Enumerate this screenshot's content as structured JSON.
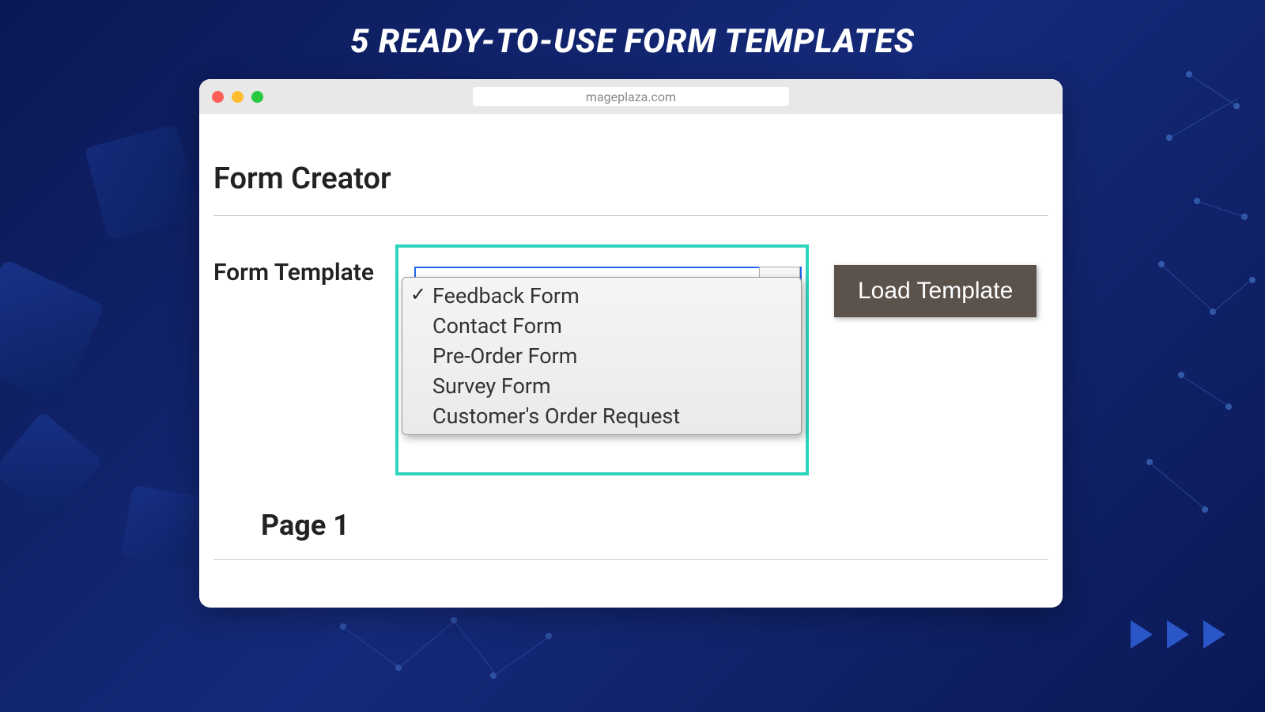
{
  "hero_title": "5 READY-TO-USE FORM TEMPLATES",
  "browser": {
    "url": "mageplaza.com"
  },
  "content": {
    "section_title": "Form Creator",
    "field_label": "Form Template",
    "dropdown_options": [
      "Feedback Form",
      "Contact Form",
      "Pre-Order Form",
      "Survey Form",
      "Customer's Order Request"
    ],
    "selected_index": 0,
    "load_button_label": "Load Template",
    "page_label": "Page 1"
  },
  "colors": {
    "highlight": "#2dd4bf",
    "button_bg": "#5c524c"
  }
}
